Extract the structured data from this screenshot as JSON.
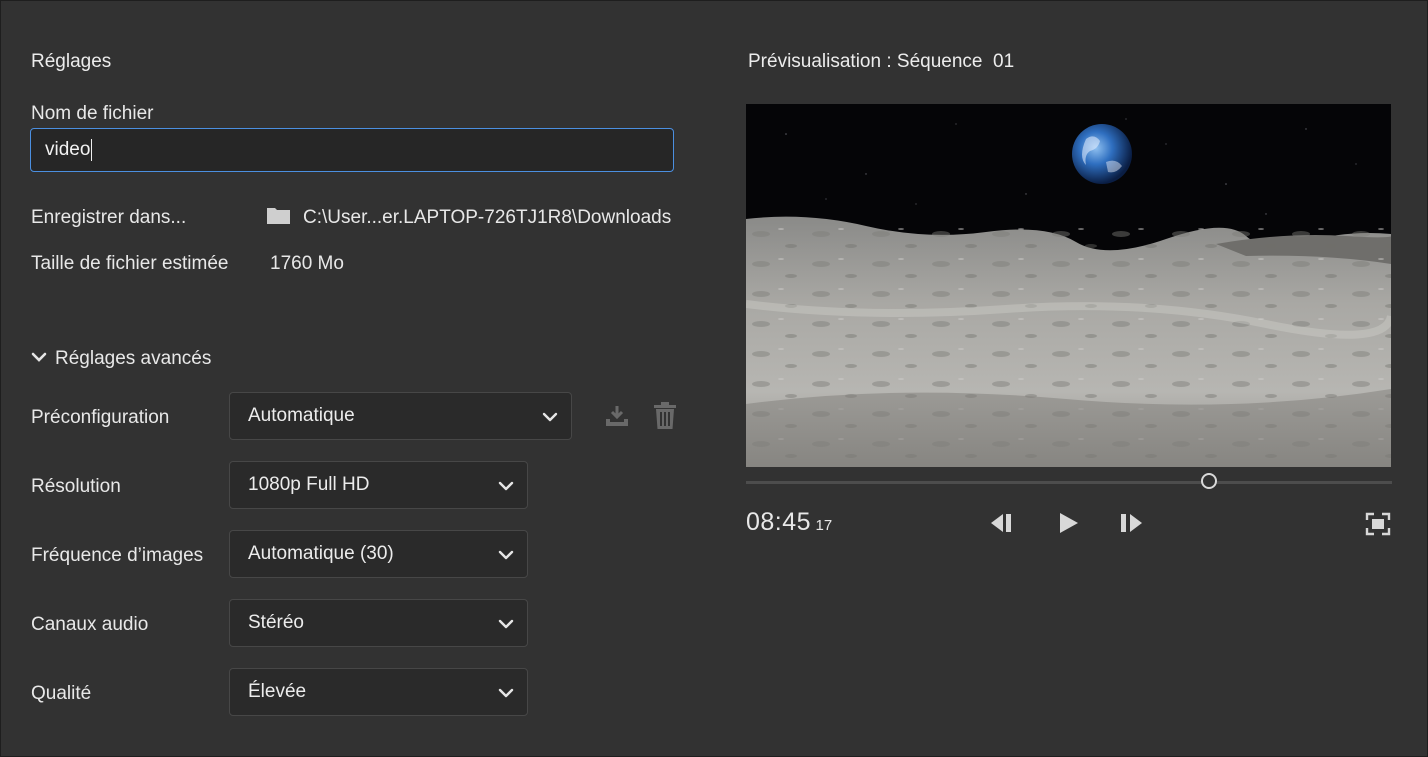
{
  "settings": {
    "title": "Réglages",
    "filename_label": "Nom de fichier",
    "filename_value": "video",
    "save_in_label": "Enregistrer dans...",
    "save_in_path": "C:\\User...er.LAPTOP-726TJ1R8\\Downloads",
    "filesize_label": "Taille de fichier estimée",
    "filesize_value": "1760 Mo"
  },
  "advanced": {
    "toggle_label": "Réglages avancés",
    "fields": [
      {
        "label": "Préconfiguration",
        "value": "Automatique"
      },
      {
        "label": "Résolution",
        "value": "1080p Full HD"
      },
      {
        "label": "Fréquence d’images",
        "value": "Automatique (30)"
      },
      {
        "label": "Canaux audio",
        "value": "Stéréo"
      },
      {
        "label": "Qualité",
        "value": "Élevée"
      }
    ]
  },
  "preview": {
    "title": "Prévisualisation : Séquence  01",
    "timecode": "08:45",
    "frame": "17",
    "playhead_fraction": 0.717
  },
  "icons": {
    "folder": "folder-icon",
    "chevron": "chevron-down-icon",
    "save_preset": "save-preset-icon",
    "delete_preset": "trash-icon",
    "step_back": "step-back-icon",
    "play": "play-icon",
    "step_forward": "step-forward-icon",
    "fullscreen": "fullscreen-icon"
  },
  "colors": {
    "background": "#323232",
    "accent": "#4b8fe0",
    "field_bg": "#2a2a2a"
  }
}
